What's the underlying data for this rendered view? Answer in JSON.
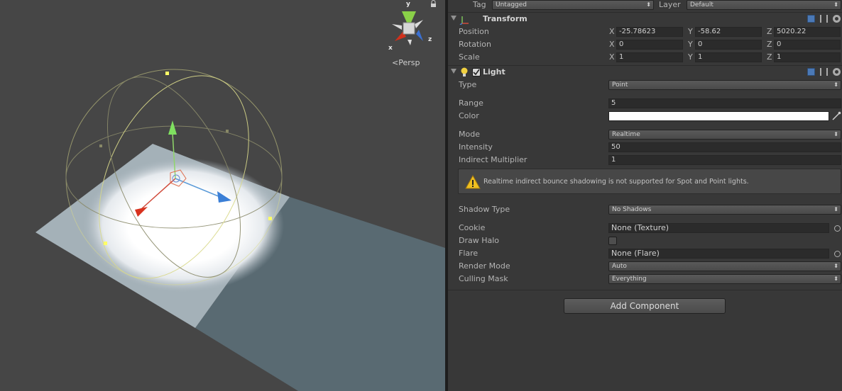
{
  "scene": {
    "projection_label": "Persp",
    "gizmo_axes": {
      "x": "x",
      "y": "y",
      "z": "z"
    }
  },
  "inspector": {
    "tag_label": "Tag",
    "tag_value": "Untagged",
    "layer_label": "Layer",
    "layer_value": "Default",
    "transform": {
      "title": "Transform",
      "position": {
        "label": "Position",
        "x": "-25.78623",
        "y": "-58.62",
        "z": "5020.22"
      },
      "rotation": {
        "label": "Rotation",
        "x": "0",
        "y": "0",
        "z": "0"
      },
      "scale": {
        "label": "Scale",
        "x": "1",
        "y": "1",
        "z": "1"
      },
      "axis_x": "X",
      "axis_y": "Y",
      "axis_z": "Z"
    },
    "light": {
      "title": "Light",
      "enabled": true,
      "type_label": "Type",
      "type_value": "Point",
      "range_label": "Range",
      "range_value": "5",
      "color_label": "Color",
      "color_value": "#ffffff",
      "mode_label": "Mode",
      "mode_value": "Realtime",
      "intensity_label": "Intensity",
      "intensity_value": "50",
      "indirect_label": "Indirect Multiplier",
      "indirect_value": "1",
      "warning": "Realtime indirect bounce shadowing is not supported for Spot and Point lights.",
      "shadow_label": "Shadow Type",
      "shadow_value": "No Shadows",
      "cookie_label": "Cookie",
      "cookie_value": "None (Texture)",
      "halo_label": "Draw Halo",
      "halo_checked": false,
      "flare_label": "Flare",
      "flare_value": "None (Flare)",
      "render_label": "Render Mode",
      "render_value": "Auto",
      "culling_label": "Culling Mask",
      "culling_value": "Everything"
    },
    "add_component_label": "Add Component"
  },
  "colors": {
    "scene_bg": "#464646",
    "inspector_bg": "#383838",
    "light_color": "#ffffff",
    "gizmo_yellow": "#e8e87a"
  }
}
